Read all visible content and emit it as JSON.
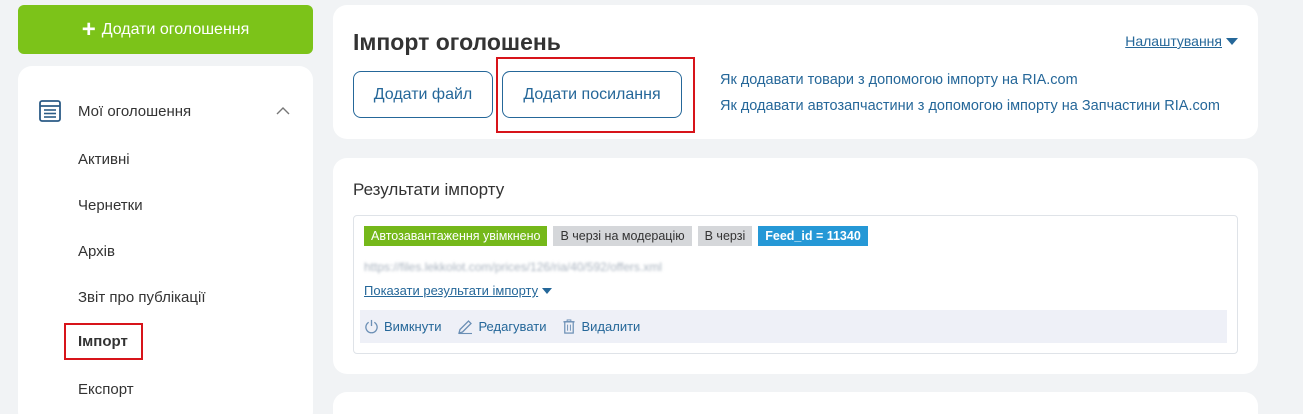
{
  "sidebar": {
    "add_button": "Додати оголошення",
    "section": "Мої оголошення",
    "items": [
      {
        "label": "Активні"
      },
      {
        "label": "Чернетки"
      },
      {
        "label": "Архів"
      },
      {
        "label": "Звіт про публікації"
      },
      {
        "label": "Імпорт",
        "active": true
      },
      {
        "label": "Експорт"
      }
    ]
  },
  "import": {
    "title": "Імпорт оголошень",
    "settings": "Налаштування",
    "add_file": "Додати файл",
    "add_link": "Додати посилання",
    "help_links": [
      "Як додавати товари з допомогою імпорту на RIA.com",
      "Як додавати автозапчастини з допомогою імпорту на Запчастини RIA.com"
    ]
  },
  "results": {
    "title": "Результати імпорту",
    "badges": {
      "autoload": "Автозавантаження увімкнено",
      "moderation": "В черзі на модерацію",
      "queue": "В черзі",
      "feed": "Feed_id = 11340"
    },
    "url": "https://files.lekkolot.com/prices/126/ria/40/592/offers.xml",
    "show_results": "Показати результати імпорту",
    "actions": {
      "disable": "Вимкнути",
      "edit": "Редагувати",
      "delete": "Видалити"
    }
  },
  "colors": {
    "accent_green": "#7cc319",
    "link_blue": "#256799",
    "highlight_red": "#d7141a"
  }
}
